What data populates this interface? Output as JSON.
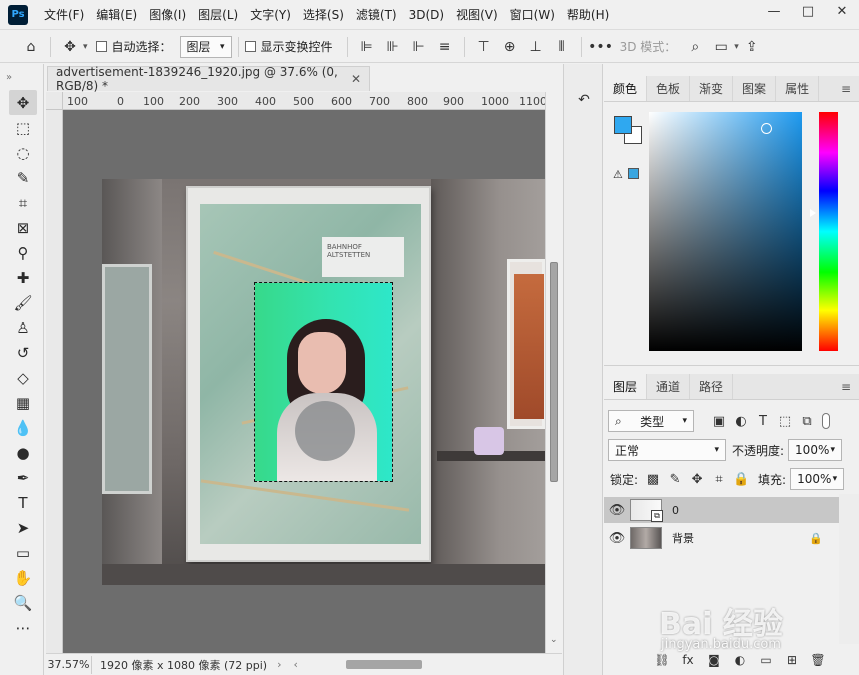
{
  "app": {
    "logo_text": "Ps",
    "menus": [
      "文件(F)",
      "编辑(E)",
      "图像(I)",
      "图层(L)",
      "文字(Y)",
      "选择(S)",
      "滤镜(T)",
      "3D(D)",
      "视图(V)",
      "窗口(W)",
      "帮助(H)"
    ],
    "window_controls": {
      "minimize": "—",
      "maximize": "□",
      "close": "✕"
    }
  },
  "options_bar": {
    "auto_select_label": "自动选择：",
    "auto_select_target": "图层",
    "show_transform_label": "显示变换控件",
    "more_label": "•••",
    "mode_3d_label": "3D 模式："
  },
  "document": {
    "tab_title": "advertisement-1839246_1920.jpg @ 37.6% (0, RGB/8) *",
    "ruler_ticks": [
      "100",
      "0",
      "100",
      "200",
      "300",
      "400",
      "500",
      "600",
      "700",
      "800",
      "900",
      "1000",
      "1100"
    ],
    "station_sign": "BAHNHOF ALTSTETTEN"
  },
  "status": {
    "zoom": "37.57%",
    "doc_info": "1920 像素 x 1080 像素 (72 ppi)"
  },
  "color_panel": {
    "tabs": [
      "颜色",
      "色板",
      "渐变",
      "图案",
      "属性"
    ],
    "foreground": "#2fa8f0",
    "background": "#ffffff"
  },
  "layers_panel": {
    "tabs": [
      "图层",
      "通道",
      "路径"
    ],
    "filter_type": "类型",
    "blend_mode": "正常",
    "opacity_label": "不透明度:",
    "opacity_value": "100%",
    "lock_label": "锁定:",
    "fill_label": "填充:",
    "fill_value": "100%",
    "layers": [
      {
        "name": "0",
        "selected": true
      },
      {
        "name": "背景",
        "selected": false
      }
    ]
  },
  "watermark": {
    "brand": "Bai 经验",
    "url": "jingyan.baidu.com"
  }
}
